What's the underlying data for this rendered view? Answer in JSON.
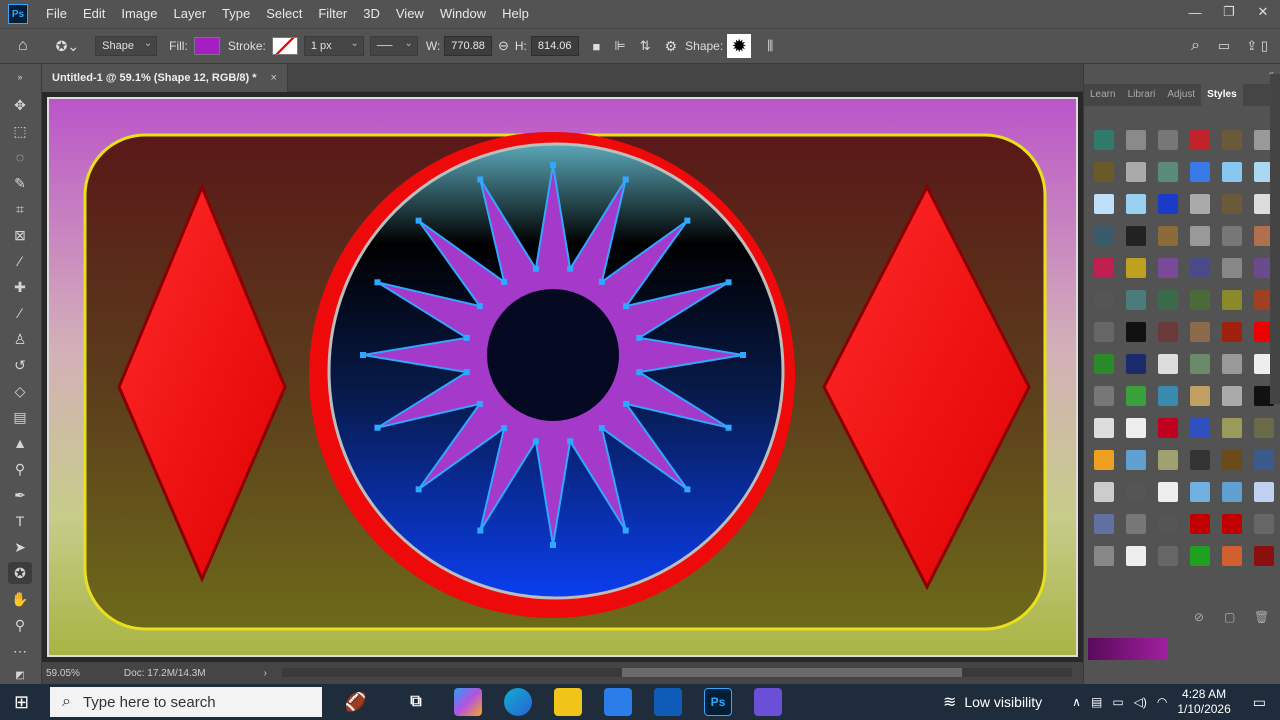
{
  "app": {
    "logo": "Ps"
  },
  "menu": [
    "File",
    "Edit",
    "Image",
    "Layer",
    "Type",
    "Select",
    "Filter",
    "3D",
    "View",
    "Window",
    "Help"
  ],
  "options": {
    "mode": "Shape",
    "fill_label": "Fill:",
    "stroke_label": "Stroke:",
    "stroke_width": "1 px",
    "w_label": "W:",
    "w_value": "770.88",
    "h_label": "H:",
    "h_value": "814.06",
    "shape_label": "Shape:",
    "fill_color": "#a31fc4"
  },
  "document": {
    "tab_title": "Untitled-1 @ 59.1% (Shape 12, RGB/8) *",
    "close": "×"
  },
  "status": {
    "zoom": "59.05%",
    "doc": "Doc: 17.2M/14.3M"
  },
  "panel": {
    "tabs": [
      "Learn",
      "Librari",
      "Adjust",
      "Styles"
    ],
    "active_tab": "Styles"
  },
  "colors": {
    "accent": "#31a8ff",
    "shape_purple": "#a539c9",
    "red": "#ff0a0a"
  },
  "taskbar": {
    "search_placeholder": "Type here to search",
    "visibility": "Low visibility",
    "time": "4:28 AM",
    "date": "1/10/2026"
  }
}
